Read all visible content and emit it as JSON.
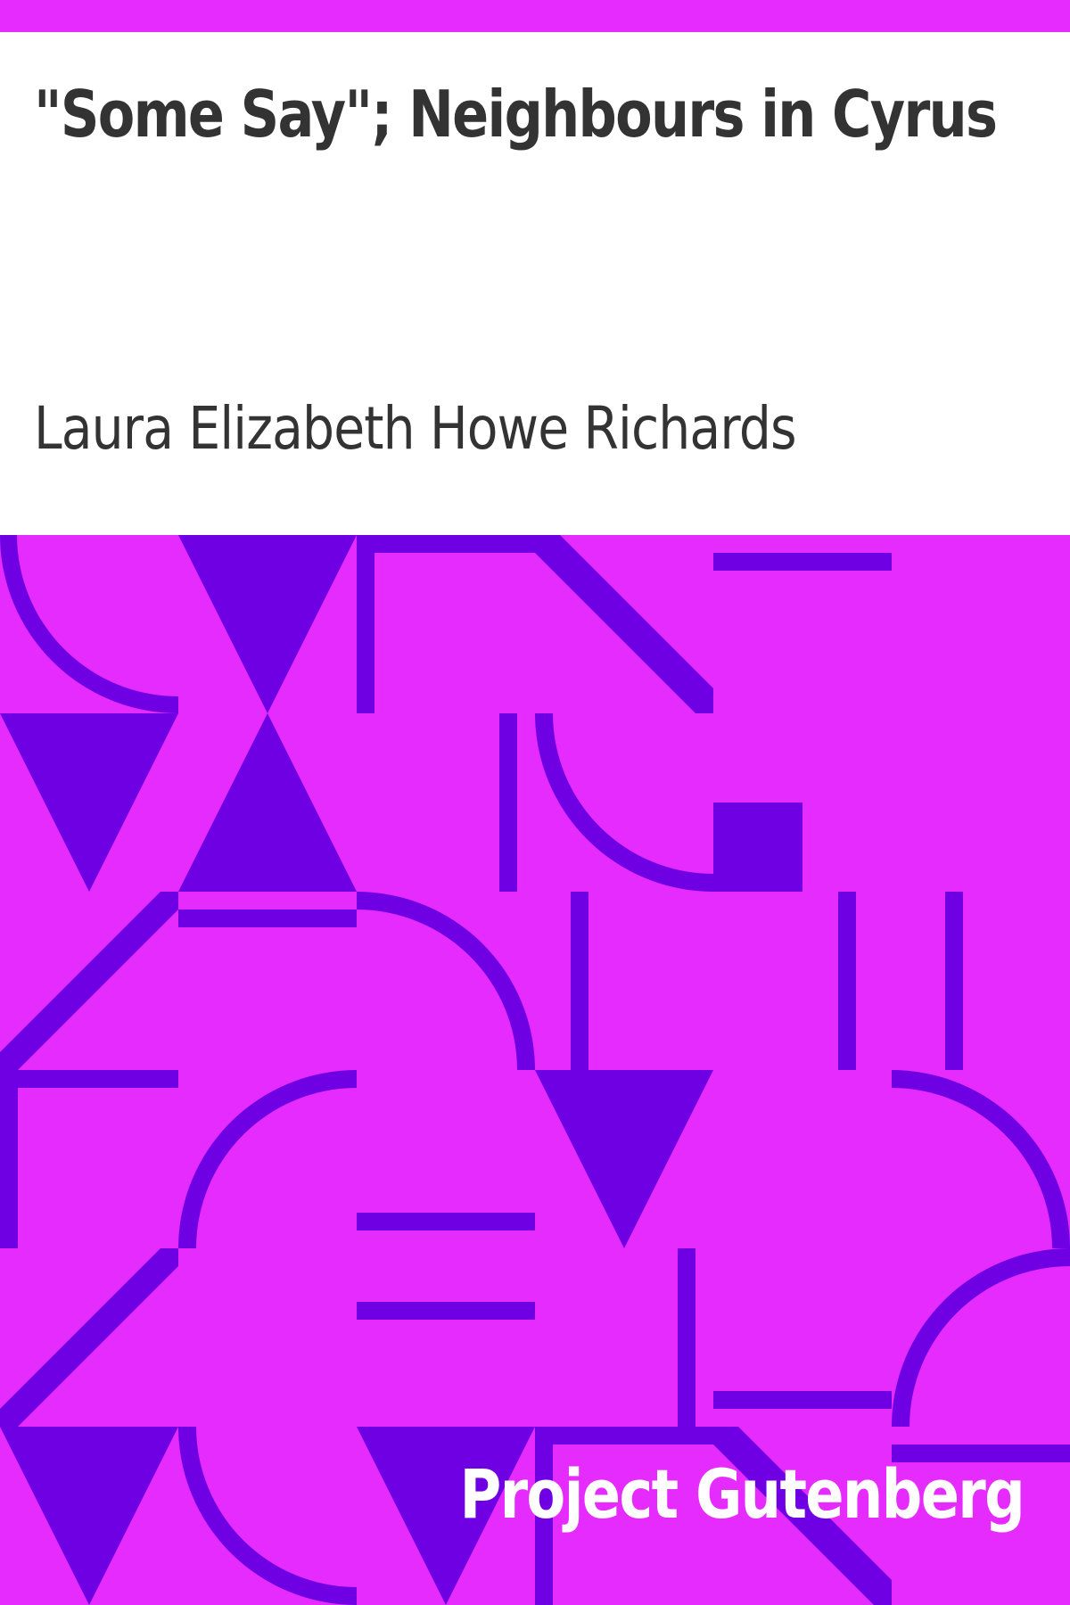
{
  "cover": {
    "title": "\"Some Say\"; Neighbours in Cyrus",
    "author": "Laura Elizabeth Howe Richards",
    "publisher": "Project Gutenberg"
  },
  "colors": {
    "background": "#ffffff",
    "accent": "#e62bff",
    "pattern": "#7000e4",
    "text": "#333333",
    "publisher_text": "#ffffff"
  }
}
